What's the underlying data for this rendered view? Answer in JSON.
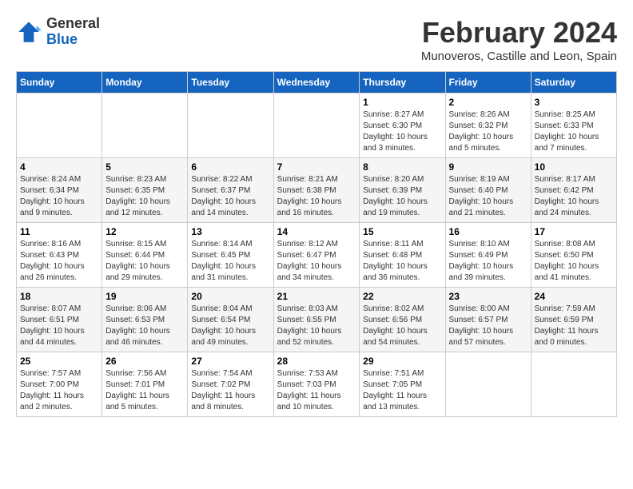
{
  "logo": {
    "general": "General",
    "blue": "Blue"
  },
  "title": {
    "month_year": "February 2024",
    "location": "Munoveros, Castille and Leon, Spain"
  },
  "headers": [
    "Sunday",
    "Monday",
    "Tuesday",
    "Wednesday",
    "Thursday",
    "Friday",
    "Saturday"
  ],
  "weeks": [
    [
      {
        "day": "",
        "sunrise": "",
        "sunset": "",
        "daylight": ""
      },
      {
        "day": "",
        "sunrise": "",
        "sunset": "",
        "daylight": ""
      },
      {
        "day": "",
        "sunrise": "",
        "sunset": "",
        "daylight": ""
      },
      {
        "day": "",
        "sunrise": "",
        "sunset": "",
        "daylight": ""
      },
      {
        "day": "1",
        "sunrise": "Sunrise: 8:27 AM",
        "sunset": "Sunset: 6:30 PM",
        "daylight": "Daylight: 10 hours and 3 minutes."
      },
      {
        "day": "2",
        "sunrise": "Sunrise: 8:26 AM",
        "sunset": "Sunset: 6:32 PM",
        "daylight": "Daylight: 10 hours and 5 minutes."
      },
      {
        "day": "3",
        "sunrise": "Sunrise: 8:25 AM",
        "sunset": "Sunset: 6:33 PM",
        "daylight": "Daylight: 10 hours and 7 minutes."
      }
    ],
    [
      {
        "day": "4",
        "sunrise": "Sunrise: 8:24 AM",
        "sunset": "Sunset: 6:34 PM",
        "daylight": "Daylight: 10 hours and 9 minutes."
      },
      {
        "day": "5",
        "sunrise": "Sunrise: 8:23 AM",
        "sunset": "Sunset: 6:35 PM",
        "daylight": "Daylight: 10 hours and 12 minutes."
      },
      {
        "day": "6",
        "sunrise": "Sunrise: 8:22 AM",
        "sunset": "Sunset: 6:37 PM",
        "daylight": "Daylight: 10 hours and 14 minutes."
      },
      {
        "day": "7",
        "sunrise": "Sunrise: 8:21 AM",
        "sunset": "Sunset: 6:38 PM",
        "daylight": "Daylight: 10 hours and 16 minutes."
      },
      {
        "day": "8",
        "sunrise": "Sunrise: 8:20 AM",
        "sunset": "Sunset: 6:39 PM",
        "daylight": "Daylight: 10 hours and 19 minutes."
      },
      {
        "day": "9",
        "sunrise": "Sunrise: 8:19 AM",
        "sunset": "Sunset: 6:40 PM",
        "daylight": "Daylight: 10 hours and 21 minutes."
      },
      {
        "day": "10",
        "sunrise": "Sunrise: 8:17 AM",
        "sunset": "Sunset: 6:42 PM",
        "daylight": "Daylight: 10 hours and 24 minutes."
      }
    ],
    [
      {
        "day": "11",
        "sunrise": "Sunrise: 8:16 AM",
        "sunset": "Sunset: 6:43 PM",
        "daylight": "Daylight: 10 hours and 26 minutes."
      },
      {
        "day": "12",
        "sunrise": "Sunrise: 8:15 AM",
        "sunset": "Sunset: 6:44 PM",
        "daylight": "Daylight: 10 hours and 29 minutes."
      },
      {
        "day": "13",
        "sunrise": "Sunrise: 8:14 AM",
        "sunset": "Sunset: 6:45 PM",
        "daylight": "Daylight: 10 hours and 31 minutes."
      },
      {
        "day": "14",
        "sunrise": "Sunrise: 8:12 AM",
        "sunset": "Sunset: 6:47 PM",
        "daylight": "Daylight: 10 hours and 34 minutes."
      },
      {
        "day": "15",
        "sunrise": "Sunrise: 8:11 AM",
        "sunset": "Sunset: 6:48 PM",
        "daylight": "Daylight: 10 hours and 36 minutes."
      },
      {
        "day": "16",
        "sunrise": "Sunrise: 8:10 AM",
        "sunset": "Sunset: 6:49 PM",
        "daylight": "Daylight: 10 hours and 39 minutes."
      },
      {
        "day": "17",
        "sunrise": "Sunrise: 8:08 AM",
        "sunset": "Sunset: 6:50 PM",
        "daylight": "Daylight: 10 hours and 41 minutes."
      }
    ],
    [
      {
        "day": "18",
        "sunrise": "Sunrise: 8:07 AM",
        "sunset": "Sunset: 6:51 PM",
        "daylight": "Daylight: 10 hours and 44 minutes."
      },
      {
        "day": "19",
        "sunrise": "Sunrise: 8:06 AM",
        "sunset": "Sunset: 6:53 PM",
        "daylight": "Daylight: 10 hours and 46 minutes."
      },
      {
        "day": "20",
        "sunrise": "Sunrise: 8:04 AM",
        "sunset": "Sunset: 6:54 PM",
        "daylight": "Daylight: 10 hours and 49 minutes."
      },
      {
        "day": "21",
        "sunrise": "Sunrise: 8:03 AM",
        "sunset": "Sunset: 6:55 PM",
        "daylight": "Daylight: 10 hours and 52 minutes."
      },
      {
        "day": "22",
        "sunrise": "Sunrise: 8:02 AM",
        "sunset": "Sunset: 6:56 PM",
        "daylight": "Daylight: 10 hours and 54 minutes."
      },
      {
        "day": "23",
        "sunrise": "Sunrise: 8:00 AM",
        "sunset": "Sunset: 6:57 PM",
        "daylight": "Daylight: 10 hours and 57 minutes."
      },
      {
        "day": "24",
        "sunrise": "Sunrise: 7:59 AM",
        "sunset": "Sunset: 6:59 PM",
        "daylight": "Daylight: 11 hours and 0 minutes."
      }
    ],
    [
      {
        "day": "25",
        "sunrise": "Sunrise: 7:57 AM",
        "sunset": "Sunset: 7:00 PM",
        "daylight": "Daylight: 11 hours and 2 minutes."
      },
      {
        "day": "26",
        "sunrise": "Sunrise: 7:56 AM",
        "sunset": "Sunset: 7:01 PM",
        "daylight": "Daylight: 11 hours and 5 minutes."
      },
      {
        "day": "27",
        "sunrise": "Sunrise: 7:54 AM",
        "sunset": "Sunset: 7:02 PM",
        "daylight": "Daylight: 11 hours and 8 minutes."
      },
      {
        "day": "28",
        "sunrise": "Sunrise: 7:53 AM",
        "sunset": "Sunset: 7:03 PM",
        "daylight": "Daylight: 11 hours and 10 minutes."
      },
      {
        "day": "29",
        "sunrise": "Sunrise: 7:51 AM",
        "sunset": "Sunset: 7:05 PM",
        "daylight": "Daylight: 11 hours and 13 minutes."
      },
      {
        "day": "",
        "sunrise": "",
        "sunset": "",
        "daylight": ""
      },
      {
        "day": "",
        "sunrise": "",
        "sunset": "",
        "daylight": ""
      }
    ]
  ]
}
